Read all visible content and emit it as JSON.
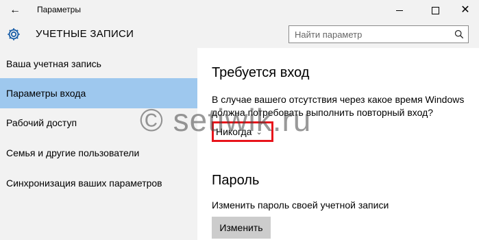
{
  "titlebar": {
    "title": "Параметры",
    "back_icon": "arrow-left-icon",
    "minimize_icon": "minimize-icon",
    "maximize_icon": "maximize-icon",
    "close_icon": "close-icon"
  },
  "header": {
    "icon": "gear-icon",
    "title": "УЧЕТНЫЕ ЗАПИСИ",
    "search_placeholder": "Найти параметр",
    "search_value": ""
  },
  "sidebar": {
    "items": [
      {
        "label": "Ваша учетная запись",
        "active": false
      },
      {
        "label": "Параметры входа",
        "active": true
      },
      {
        "label": "Рабочий доступ",
        "active": false
      },
      {
        "label": "Семья и другие пользователи",
        "active": false
      },
      {
        "label": "Синхронизация ваших параметров",
        "active": false
      }
    ]
  },
  "signin": {
    "heading": "Требуется вход",
    "description_line1": "В случае вашего отсутствия через какое время Windows",
    "description_line2": "должна потребовать выполнить повторный вход?",
    "dropdown_value": "Никогда"
  },
  "password": {
    "heading": "Пароль",
    "description": "Изменить пароль своей учетной записи",
    "button_label": "Изменить"
  },
  "watermark": {
    "text": "© setiwik.ru"
  },
  "colors": {
    "active_nav": "#9ec8ee",
    "highlight": "#e8141b",
    "chrome": "#f2f2f2"
  }
}
